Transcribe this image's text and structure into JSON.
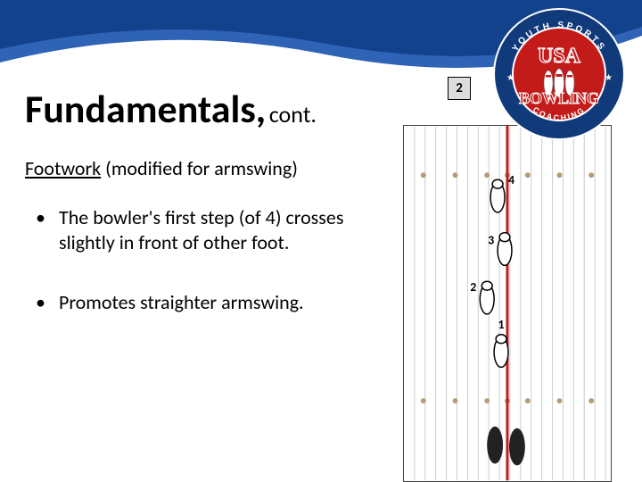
{
  "header": {
    "title_main": "Fundamentals,",
    "title_cont": "cont."
  },
  "subtitle": {
    "underlined": "Footwork",
    "rest": " (modified for armswing)"
  },
  "bullets": [
    "The bowler's first step (of 4) crosses slightly in front of other foot.",
    "Promotes straighter armswing."
  ],
  "sequence_box": "2",
  "lane": {
    "step_labels": [
      "1",
      "2",
      "3",
      "4"
    ]
  },
  "logo": {
    "top_arc": "YOUTH SPORTS",
    "mid_top": "USA",
    "mid_bottom": "BOWLING",
    "bottom_arc": "COACHING"
  },
  "colors": {
    "band": "#13428d",
    "band_light": "#2f63b5",
    "logo_outer": "#103a7a",
    "logo_inner": "#c31a1a",
    "lane_line": "#c31a1a"
  }
}
